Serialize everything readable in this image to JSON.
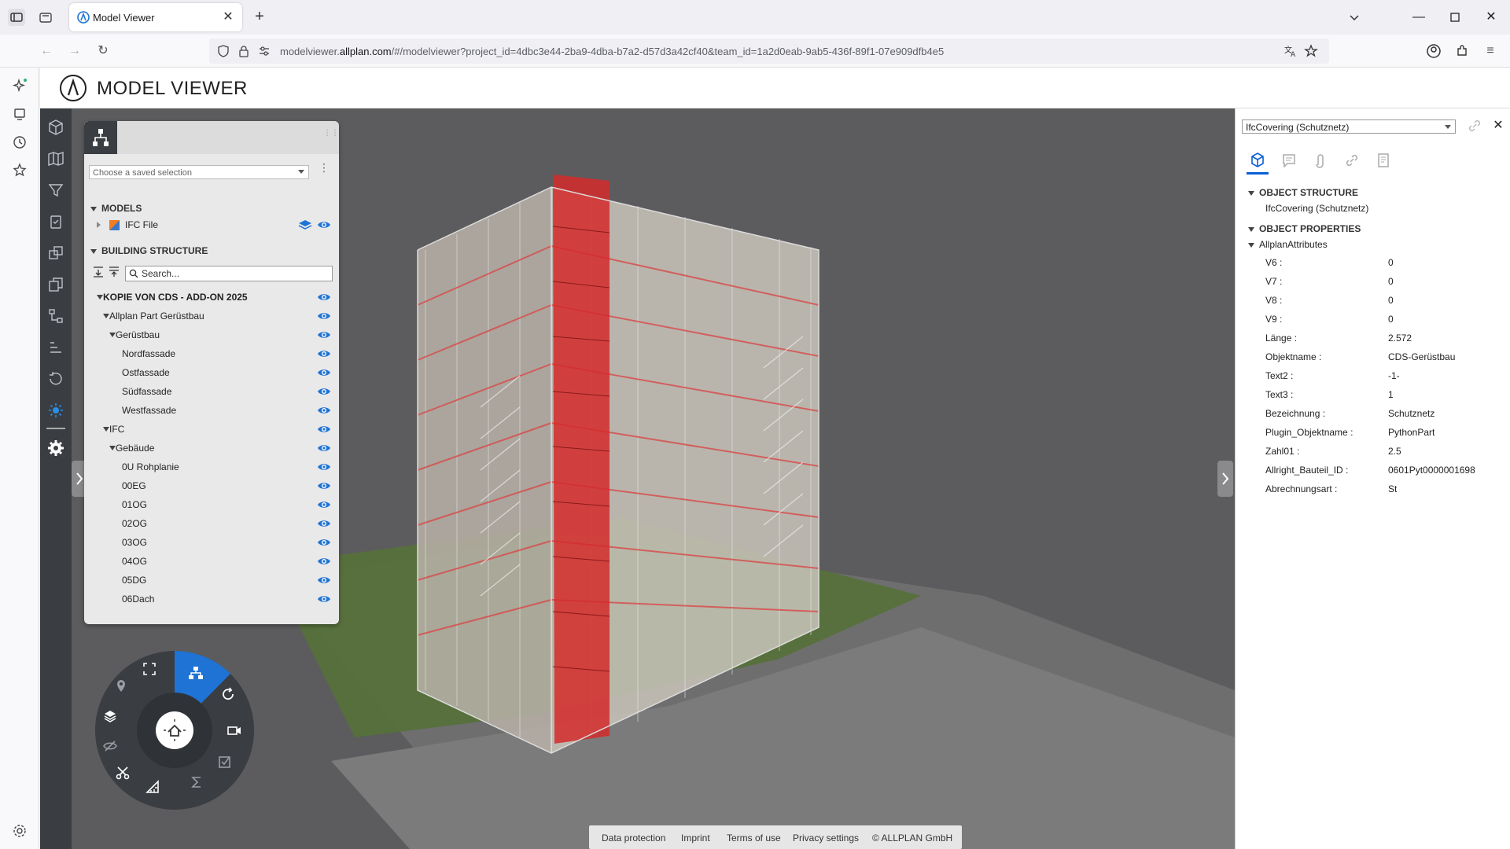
{
  "browser": {
    "tab_title": "Model Viewer",
    "url_prefix": "modelviewer.",
    "url_domain": "allplan.com",
    "url_path": "/#/modelviewer?project_id=4dbc3e44-2ba9-4dba-b7a2-d57d3a42cf40&team_id=1a2d0eab-9ab5-436f-89f1-07e909dfb4e5"
  },
  "app": {
    "title": "MODEL VIEWER"
  },
  "structure_panel": {
    "saved_selection_placeholder": "Choose a saved selection",
    "models_title": "MODELS",
    "model_item": "IFC File",
    "building_structure_title": "BUILDING STRUCTURE",
    "search_placeholder": "Search...",
    "tree": [
      {
        "label": "KOPIE VON CDS - ADD-ON 2025",
        "bold": true
      },
      {
        "label": "Allplan Part Gerüstbau"
      },
      {
        "label": "Gerüstbau"
      },
      {
        "label": "Nordfassade"
      },
      {
        "label": "Ostfassade"
      },
      {
        "label": "Südfassade"
      },
      {
        "label": "Westfassade"
      },
      {
        "label": "IFC"
      },
      {
        "label": "Gebäude"
      },
      {
        "label": "0U Rohplanie"
      },
      {
        "label": "00EG"
      },
      {
        "label": "01OG"
      },
      {
        "label": "02OG"
      },
      {
        "label": "03OG"
      },
      {
        "label": "04OG"
      },
      {
        "label": "05DG"
      },
      {
        "label": "06Dach"
      }
    ]
  },
  "properties": {
    "selected_object": "IfcCovering (Schutznetz)",
    "object_structure_title": "OBJECT STRUCTURE",
    "object_structure_value": "IfcCovering (Schutznetz)",
    "object_properties_title": "OBJECT PROPERTIES",
    "group_title": "AllplanAttributes",
    "rows": [
      {
        "key": "V6 :",
        "value": "0"
      },
      {
        "key": "V7 :",
        "value": "0"
      },
      {
        "key": "V8 :",
        "value": "0"
      },
      {
        "key": "V9 :",
        "value": "0"
      },
      {
        "key": "Länge :",
        "value": "2.572"
      },
      {
        "key": "Objektname :",
        "value": "CDS-Gerüstbau"
      },
      {
        "key": "Text2 :",
        "value": "-1-"
      },
      {
        "key": "Text3 :",
        "value": "1"
      },
      {
        "key": "Bezeichnung :",
        "value": "Schutznetz"
      },
      {
        "key": "Plugin_Objektname :",
        "value": "PythonPart"
      },
      {
        "key": "Zahl01 :",
        "value": "2.5"
      },
      {
        "key": "Allright_Bauteil_ID :",
        "value": "0601Pyt0000001698"
      },
      {
        "key": "Abrechnungsart :",
        "value": "St"
      }
    ]
  },
  "footer": {
    "links": [
      "Data protection",
      "Imprint",
      "Terms of use",
      "Privacy settings",
      "© ALLPLAN GmbH"
    ]
  },
  "colors": {
    "accent": "#0a5fd6",
    "rail": "#3a3d42",
    "viewport": "#5c5c5e",
    "highlight": "#d42a2a",
    "grass": "#55703a"
  }
}
